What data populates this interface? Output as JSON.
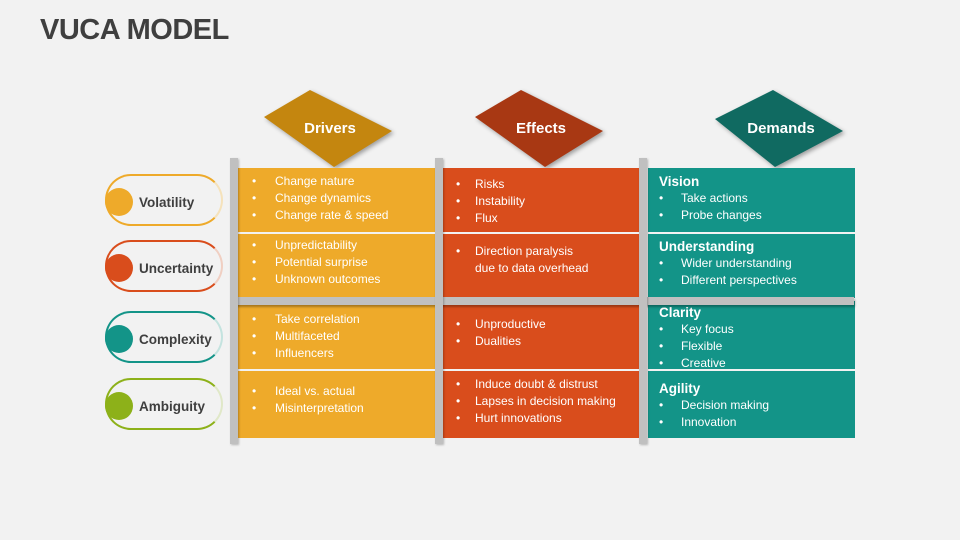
{
  "title": "VUCA MODEL",
  "colors": {
    "drivers_header": "#c4860f",
    "effects_header": "#a83813",
    "demands_header": "#106a61",
    "drivers_cell": "#eeaa2a",
    "effects_cell": "#d94d1c",
    "demands_cell": "#139488",
    "volatility": "#eeaa2a",
    "uncertainty": "#d94d1c",
    "complexity": "#139488",
    "ambiguity": "#8db119"
  },
  "columns": [
    "Drivers",
    "Effects",
    "Demands"
  ],
  "rows": [
    {
      "label": "Volatility",
      "drivers": [
        "Change nature",
        "Change dynamics",
        "Change rate & speed"
      ],
      "effects": [
        "Risks",
        "Instability",
        "Flux"
      ],
      "demand_title": "Vision",
      "demands": [
        "Take actions",
        "Probe changes"
      ]
    },
    {
      "label": "Uncertainty",
      "drivers": [
        "Unpredictability",
        "Potential surprise",
        "Unknown outcomes"
      ],
      "effects": [
        "Direction paralysis due to data overhead"
      ],
      "demand_title": "Understanding",
      "demands": [
        "Wider understanding",
        "Different perspectives"
      ]
    },
    {
      "label": "Complexity",
      "drivers": [
        "Take correlation",
        "Multifaceted",
        "Influencers"
      ],
      "effects": [
        "Unproductive",
        "Dualities"
      ],
      "demand_title": "Clarity",
      "demands": [
        "Key focus",
        "Flexible",
        "Creative"
      ]
    },
    {
      "label": "Ambiguity",
      "drivers": [
        "Ideal vs. actual",
        "Misinterpretation"
      ],
      "effects": [
        "Induce doubt & distrust",
        "Lapses in decision making",
        "Hurt innovations"
      ],
      "demand_title": "Agility",
      "demands": [
        "Decision making",
        "Innovation"
      ]
    }
  ]
}
